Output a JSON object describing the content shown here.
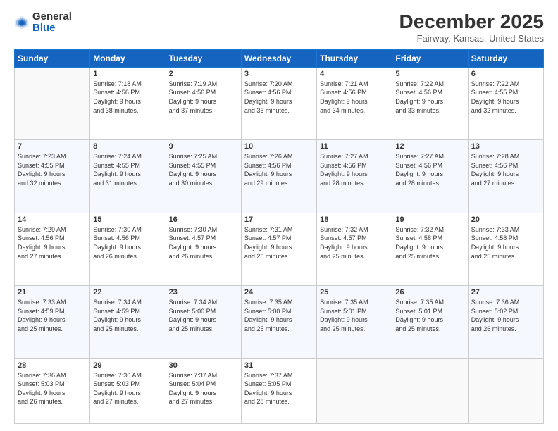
{
  "header": {
    "logo_general": "General",
    "logo_blue": "Blue",
    "title": "December 2025",
    "subtitle": "Fairway, Kansas, United States"
  },
  "days_of_week": [
    "Sunday",
    "Monday",
    "Tuesday",
    "Wednesday",
    "Thursday",
    "Friday",
    "Saturday"
  ],
  "weeks": [
    [
      {
        "day": "",
        "info": ""
      },
      {
        "day": "1",
        "info": "Sunrise: 7:18 AM\nSunset: 4:56 PM\nDaylight: 9 hours\nand 38 minutes."
      },
      {
        "day": "2",
        "info": "Sunrise: 7:19 AM\nSunset: 4:56 PM\nDaylight: 9 hours\nand 37 minutes."
      },
      {
        "day": "3",
        "info": "Sunrise: 7:20 AM\nSunset: 4:56 PM\nDaylight: 9 hours\nand 36 minutes."
      },
      {
        "day": "4",
        "info": "Sunrise: 7:21 AM\nSunset: 4:56 PM\nDaylight: 9 hours\nand 34 minutes."
      },
      {
        "day": "5",
        "info": "Sunrise: 7:22 AM\nSunset: 4:56 PM\nDaylight: 9 hours\nand 33 minutes."
      },
      {
        "day": "6",
        "info": "Sunrise: 7:22 AM\nSunset: 4:55 PM\nDaylight: 9 hours\nand 32 minutes."
      }
    ],
    [
      {
        "day": "7",
        "info": "Sunrise: 7:23 AM\nSunset: 4:55 PM\nDaylight: 9 hours\nand 32 minutes."
      },
      {
        "day": "8",
        "info": "Sunrise: 7:24 AM\nSunset: 4:55 PM\nDaylight: 9 hours\nand 31 minutes."
      },
      {
        "day": "9",
        "info": "Sunrise: 7:25 AM\nSunset: 4:55 PM\nDaylight: 9 hours\nand 30 minutes."
      },
      {
        "day": "10",
        "info": "Sunrise: 7:26 AM\nSunset: 4:56 PM\nDaylight: 9 hours\nand 29 minutes."
      },
      {
        "day": "11",
        "info": "Sunrise: 7:27 AM\nSunset: 4:56 PM\nDaylight: 9 hours\nand 28 minutes."
      },
      {
        "day": "12",
        "info": "Sunrise: 7:27 AM\nSunset: 4:56 PM\nDaylight: 9 hours\nand 28 minutes."
      },
      {
        "day": "13",
        "info": "Sunrise: 7:28 AM\nSunset: 4:56 PM\nDaylight: 9 hours\nand 27 minutes."
      }
    ],
    [
      {
        "day": "14",
        "info": "Sunrise: 7:29 AM\nSunset: 4:56 PM\nDaylight: 9 hours\nand 27 minutes."
      },
      {
        "day": "15",
        "info": "Sunrise: 7:30 AM\nSunset: 4:56 PM\nDaylight: 9 hours\nand 26 minutes."
      },
      {
        "day": "16",
        "info": "Sunrise: 7:30 AM\nSunset: 4:57 PM\nDaylight: 9 hours\nand 26 minutes."
      },
      {
        "day": "17",
        "info": "Sunrise: 7:31 AM\nSunset: 4:57 PM\nDaylight: 9 hours\nand 26 minutes."
      },
      {
        "day": "18",
        "info": "Sunrise: 7:32 AM\nSunset: 4:57 PM\nDaylight: 9 hours\nand 25 minutes."
      },
      {
        "day": "19",
        "info": "Sunrise: 7:32 AM\nSunset: 4:58 PM\nDaylight: 9 hours\nand 25 minutes."
      },
      {
        "day": "20",
        "info": "Sunrise: 7:33 AM\nSunset: 4:58 PM\nDaylight: 9 hours\nand 25 minutes."
      }
    ],
    [
      {
        "day": "21",
        "info": "Sunrise: 7:33 AM\nSunset: 4:59 PM\nDaylight: 9 hours\nand 25 minutes."
      },
      {
        "day": "22",
        "info": "Sunrise: 7:34 AM\nSunset: 4:59 PM\nDaylight: 9 hours\nand 25 minutes."
      },
      {
        "day": "23",
        "info": "Sunrise: 7:34 AM\nSunset: 5:00 PM\nDaylight: 9 hours\nand 25 minutes."
      },
      {
        "day": "24",
        "info": "Sunrise: 7:35 AM\nSunset: 5:00 PM\nDaylight: 9 hours\nand 25 minutes."
      },
      {
        "day": "25",
        "info": "Sunrise: 7:35 AM\nSunset: 5:01 PM\nDaylight: 9 hours\nand 25 minutes."
      },
      {
        "day": "26",
        "info": "Sunrise: 7:35 AM\nSunset: 5:01 PM\nDaylight: 9 hours\nand 25 minutes."
      },
      {
        "day": "27",
        "info": "Sunrise: 7:36 AM\nSunset: 5:02 PM\nDaylight: 9 hours\nand 26 minutes."
      }
    ],
    [
      {
        "day": "28",
        "info": "Sunrise: 7:36 AM\nSunset: 5:03 PM\nDaylight: 9 hours\nand 26 minutes."
      },
      {
        "day": "29",
        "info": "Sunrise: 7:36 AM\nSunset: 5:03 PM\nDaylight: 9 hours\nand 27 minutes."
      },
      {
        "day": "30",
        "info": "Sunrise: 7:37 AM\nSunset: 5:04 PM\nDaylight: 9 hours\nand 27 minutes."
      },
      {
        "day": "31",
        "info": "Sunrise: 7:37 AM\nSunset: 5:05 PM\nDaylight: 9 hours\nand 28 minutes."
      },
      {
        "day": "",
        "info": ""
      },
      {
        "day": "",
        "info": ""
      },
      {
        "day": "",
        "info": ""
      }
    ]
  ]
}
